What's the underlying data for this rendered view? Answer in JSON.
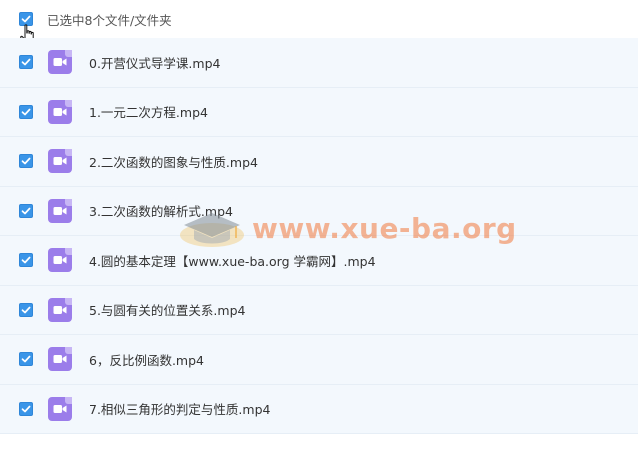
{
  "header": {
    "selection_label": "已选中8个文件/文件夹"
  },
  "files": [
    {
      "name": "0.开营仪式导学课.mp4",
      "checked": true
    },
    {
      "name": "1.一元二次方程.mp4",
      "checked": true
    },
    {
      "name": "2.二次函数的图象与性质.mp4",
      "checked": true
    },
    {
      "name": "3.二次函数的解析式.mp4",
      "checked": true
    },
    {
      "name": "4.圆的基本定理【www.xue-ba.org 学霸网】.mp4",
      "checked": true
    },
    {
      "name": "5.与圆有关的位置关系.mp4",
      "checked": true
    },
    {
      "name": "6，反比例函数.mp4",
      "checked": true
    },
    {
      "name": "7.相似三角形的判定与性质.mp4",
      "checked": true
    }
  ],
  "watermark": {
    "text": "www.xue-ba.org"
  },
  "colors": {
    "checkbox": "#3a95e8",
    "video_icon": "#9b7dea",
    "row_bg": "#f3f8fd"
  }
}
